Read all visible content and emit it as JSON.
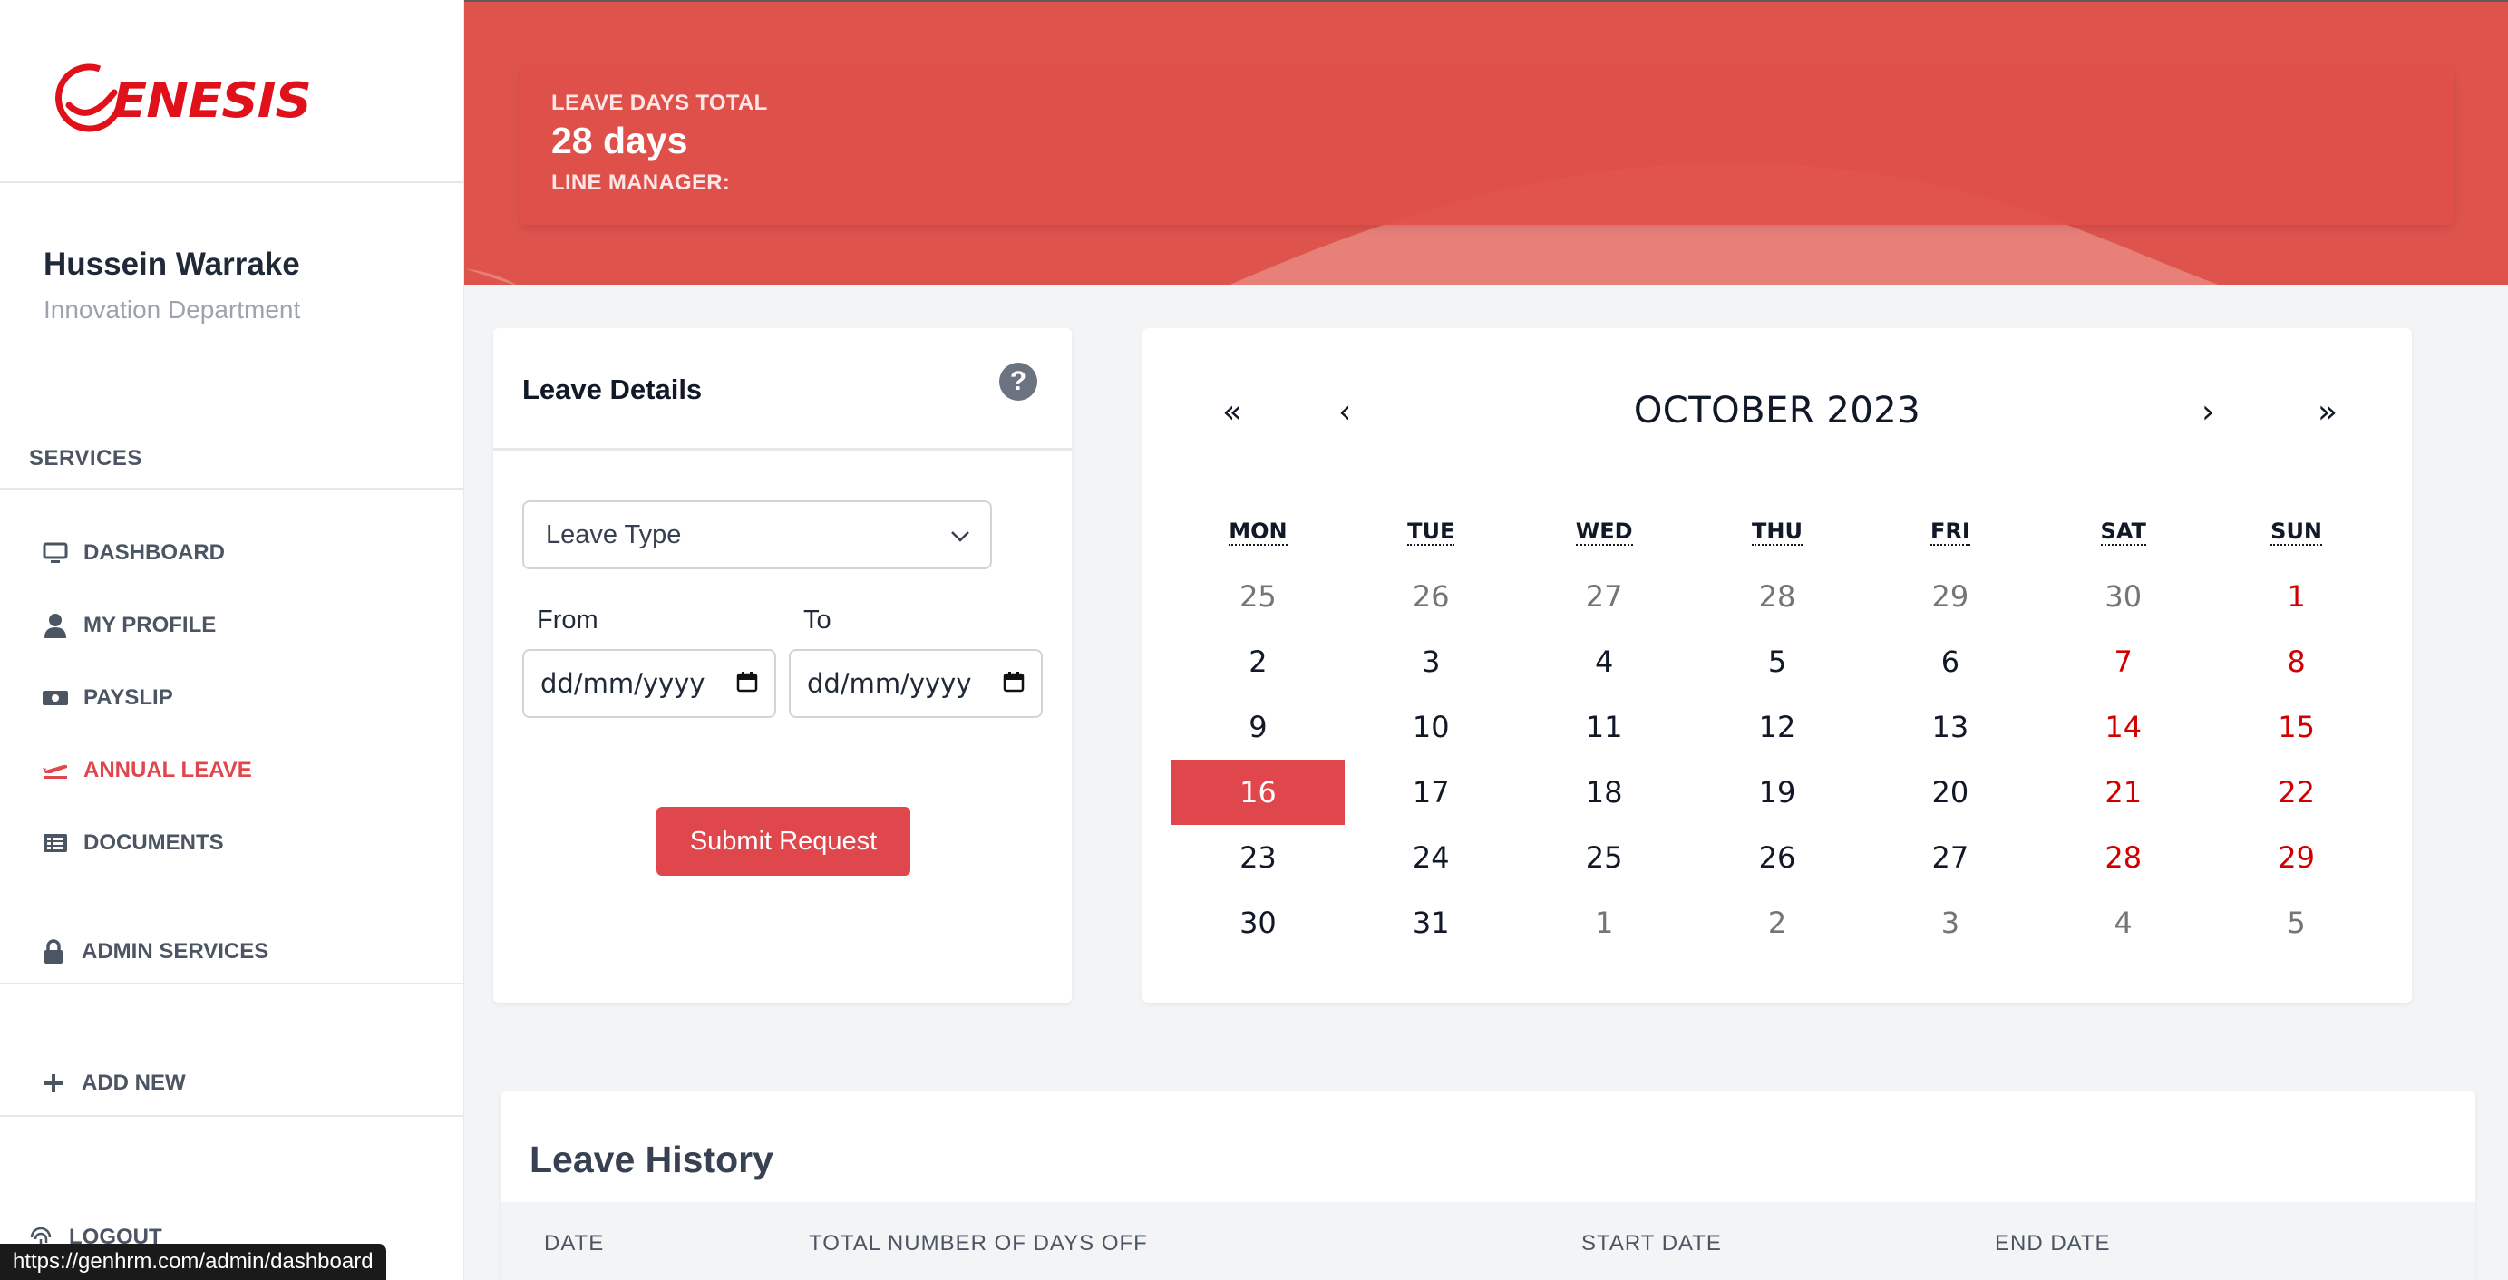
{
  "sidebar": {
    "logo_text": "ENESIS",
    "user_name": "Hussein Warrake",
    "user_department": "Innovation Department",
    "services_label": "SERVICES",
    "items": [
      {
        "label": "DASHBOARD",
        "icon": "monitor-icon"
      },
      {
        "label": "MY PROFILE",
        "icon": "user-icon"
      },
      {
        "label": "PAYSLIP",
        "icon": "money-icon"
      },
      {
        "label": "ANNUAL LEAVE",
        "icon": "plane-icon",
        "active": true
      },
      {
        "label": "DOCUMENTS",
        "icon": "documents-icon"
      }
    ],
    "admin_label": "ADMIN SERVICES",
    "add_new_label": "ADD NEW",
    "logout_label": "LOGOUT"
  },
  "status_url": "https://genhrm.com/admin/dashboard",
  "header": {
    "leave_days_label": "LEAVE DAYS TOTAL",
    "leave_days_value": "28 days",
    "line_manager_label": "LINE MANAGER:"
  },
  "leave_details": {
    "title": "Leave Details",
    "help_icon": "question-circle-icon",
    "leave_type_placeholder": "Leave Type",
    "from_label": "From",
    "to_label": "To",
    "from_value": "dd/mm/yyyy",
    "to_value": "dd/mm/yyyy",
    "submit_label": "Submit Request"
  },
  "calendar": {
    "title": "OCTOBER 2023",
    "prev_year": "«",
    "prev_month": "‹",
    "next_month": "›",
    "next_year": "»",
    "weekdays": [
      "MON",
      "TUE",
      "WED",
      "THU",
      "FRI",
      "SAT",
      "SUN"
    ],
    "weeks": [
      [
        "25",
        "26",
        "27",
        "28",
        "29",
        "30",
        "1"
      ],
      [
        "2",
        "3",
        "4",
        "5",
        "6",
        "7",
        "8"
      ],
      [
        "9",
        "10",
        "11",
        "12",
        "13",
        "14",
        "15"
      ],
      [
        "16",
        "17",
        "18",
        "19",
        "20",
        "21",
        "22"
      ],
      [
        "23",
        "24",
        "25",
        "26",
        "27",
        "28",
        "29"
      ],
      [
        "30",
        "31",
        "1",
        "2",
        "3",
        "4",
        "5"
      ]
    ],
    "today": "16",
    "accent_color": "#e0474c",
    "weekend_color": "#d10000"
  },
  "leave_history": {
    "title": "Leave History",
    "columns": [
      "DATE",
      "TOTAL NUMBER OF DAYS OFF",
      "START DATE",
      "END DATE"
    ]
  },
  "colors": {
    "brand_red": "#e0111b",
    "header_red": "#df534d",
    "accent": "#e0474c"
  }
}
